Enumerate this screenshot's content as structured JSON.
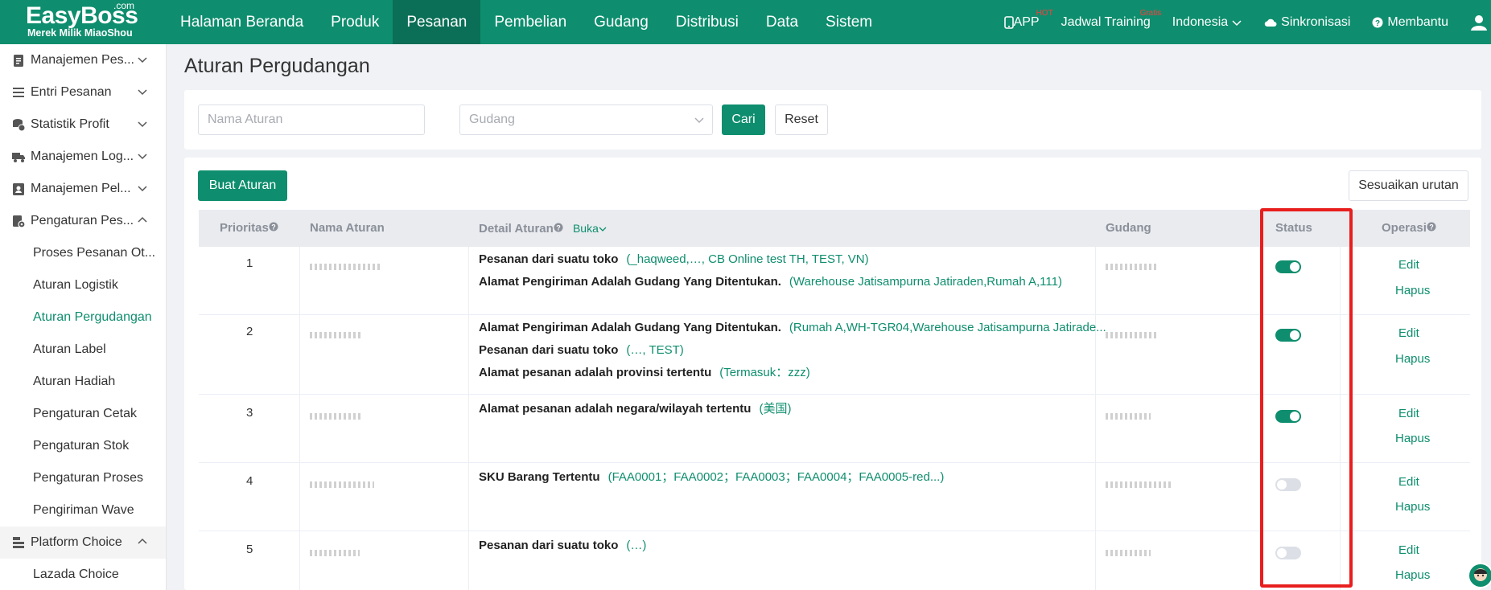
{
  "brand": {
    "name": "EasyBoss",
    "tld": ".com",
    "tagline": "Merek Milik MiaoShou"
  },
  "nav": {
    "items": [
      "Halaman Beranda",
      "Produk",
      "Pesanan",
      "Pembelian",
      "Gudang",
      "Distribusi",
      "Data",
      "Sistem"
    ],
    "active": "Pesanan",
    "right": {
      "app": "APP",
      "app_badge": "HOT",
      "training": "Jadwal Training",
      "training_badge": "Gratis",
      "language": "Indonesia",
      "sync": "Sinkronisasi",
      "help": "Membantu"
    }
  },
  "sidebar": {
    "groups": [
      {
        "label": "Manajemen Pes...",
        "icon": "clipboard-icon"
      },
      {
        "label": "Entri Pesanan",
        "icon": "list-icon"
      },
      {
        "label": "Statistik Profit",
        "icon": "coins-icon"
      },
      {
        "label": "Manajemen Log...",
        "icon": "truck-icon"
      },
      {
        "label": "Manajemen Pel...",
        "icon": "user-card-icon"
      },
      {
        "label": "Pengaturan Pes...",
        "icon": "settings-doc-icon"
      }
    ],
    "sub_items": [
      "Proses Pesanan Ot...",
      "Aturan Logistik",
      "Aturan Pergudangan",
      "Aturan Label",
      "Aturan Hadiah",
      "Pengaturan Cetak",
      "Pengaturan Stok",
      "Pengaturan Proses",
      "Pengiriman Wave"
    ],
    "active_sub": "Aturan Pergudangan",
    "platform": {
      "label": "Platform Choice",
      "icon": "stack-icon",
      "children": [
        "Lazada Choice"
      ]
    }
  },
  "page": {
    "title": "Aturan Pergudangan"
  },
  "filters": {
    "rule_name_placeholder": "Nama Aturan",
    "warehouse_placeholder": "Gudang",
    "search_label": "Cari",
    "reset_label": "Reset"
  },
  "actions": {
    "create_label": "Buat Aturan",
    "sort_label": "Sesuaikan urutan"
  },
  "table": {
    "headers": {
      "priority": "Prioritas",
      "name": "Nama Aturan",
      "detail": "Detail Aturan",
      "expand": "Buka",
      "warehouse": "Gudang",
      "status": "Status",
      "operation": "Operasi"
    },
    "rows": [
      {
        "priority": "1",
        "status": true,
        "lines": [
          {
            "label": "Pesanan dari suatu toko",
            "value": "(_haqweed,…, CB Online test TH, TEST, VN)"
          },
          {
            "label": "Alamat Pengiriman Adalah Gudang Yang Ditentukan.",
            "value": "(Warehouse Jatisampurna Jatiraden,Rumah A,111)"
          }
        ]
      },
      {
        "priority": "2",
        "status": true,
        "lines": [
          {
            "label": "Alamat Pengiriman Adalah Gudang Yang Ditentukan.",
            "value": "(Rumah A,WH-TGR04,Warehouse Jatisampurna Jatirade..."
          },
          {
            "label": "Pesanan dari suatu toko",
            "value": "(…, TEST)"
          },
          {
            "label": "Alamat pesanan adalah provinsi tertentu",
            "value": "(Termasuk：zzz)"
          }
        ]
      },
      {
        "priority": "3",
        "status": true,
        "lines": [
          {
            "label": "Alamat pesanan adalah negara/wilayah tertentu",
            "value": "(美国)"
          }
        ]
      },
      {
        "priority": "4",
        "status": false,
        "lines": [
          {
            "label": "SKU Barang Tertentu",
            "value": "(FAA0001；FAA0002；FAA0003；FAA0004；FAA0005-red...)"
          }
        ]
      },
      {
        "priority": "5",
        "status": false,
        "lines": [
          {
            "label": "Pesanan dari suatu toko",
            "value": "(…)"
          }
        ]
      }
    ],
    "op_edit": "Edit",
    "op_delete": "Hapus"
  },
  "colors": {
    "brand": "#0e8e6e",
    "highlight": "#e81e1e"
  }
}
